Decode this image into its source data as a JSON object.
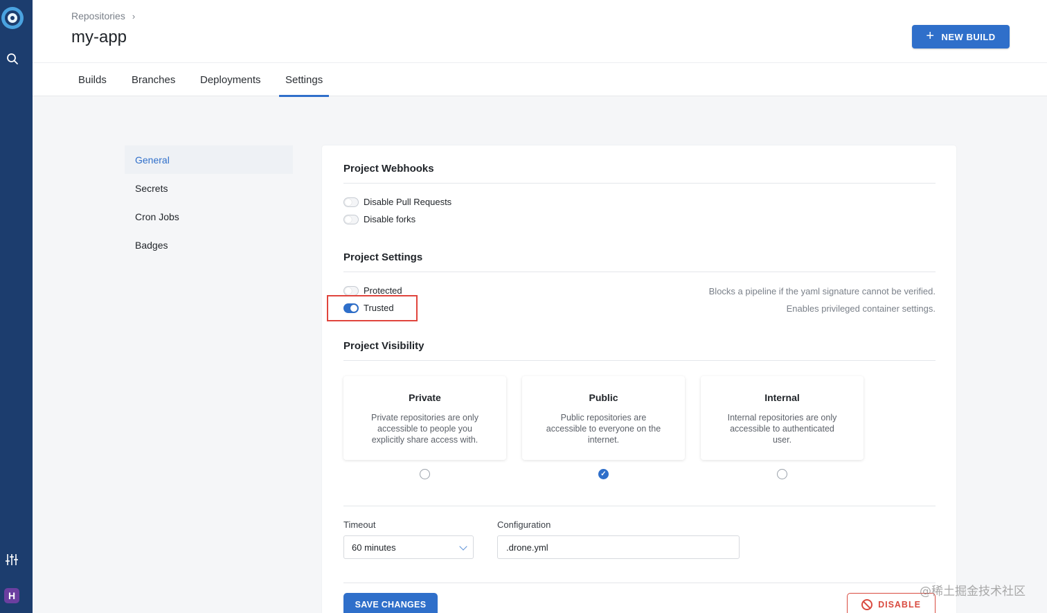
{
  "header": {
    "breadcrumb": "Repositories",
    "title": "my-app",
    "new_build_label": "NEW BUILD"
  },
  "tabs": [
    {
      "label": "Builds",
      "active": false
    },
    {
      "label": "Branches",
      "active": false
    },
    {
      "label": "Deployments",
      "active": false
    },
    {
      "label": "Settings",
      "active": true
    }
  ],
  "subnav": [
    {
      "label": "General",
      "active": true
    },
    {
      "label": "Secrets",
      "active": false
    },
    {
      "label": "Cron Jobs",
      "active": false
    },
    {
      "label": "Badges",
      "active": false
    }
  ],
  "webhooks": {
    "title": "Project Webhooks",
    "disable_pull_requests": {
      "label": "Disable Pull Requests",
      "on": false
    },
    "disable_forks": {
      "label": "Disable forks",
      "on": false
    }
  },
  "project_settings": {
    "title": "Project Settings",
    "protected": {
      "label": "Protected",
      "on": false,
      "hint": "Blocks a pipeline if the yaml signature cannot be verified."
    },
    "trusted": {
      "label": "Trusted",
      "on": true,
      "hint": "Enables privileged container settings."
    }
  },
  "visibility": {
    "title": "Project Visibility",
    "options": [
      {
        "title": "Private",
        "desc": "Private repositories are only accessible to people you explicitly share access with.",
        "selected": false
      },
      {
        "title": "Public",
        "desc": "Public repositories are accessible to everyone on the internet.",
        "selected": true
      },
      {
        "title": "Internal",
        "desc": "Internal repositories are only accessible to authenticated user.",
        "selected": false
      }
    ]
  },
  "timeout": {
    "label": "Timeout",
    "value": "60 minutes"
  },
  "configuration": {
    "label": "Configuration",
    "value": ".drone.yml"
  },
  "actions": {
    "save": "SAVE CHANGES",
    "disable": "DISABLE"
  },
  "user_initial": "H",
  "watermark": "@稀土掘金技术社区",
  "colors": {
    "accent": "#2f6fca",
    "rail": "#1c3d6e",
    "danger": "#d94a3f",
    "highlight": "#e0443c"
  }
}
